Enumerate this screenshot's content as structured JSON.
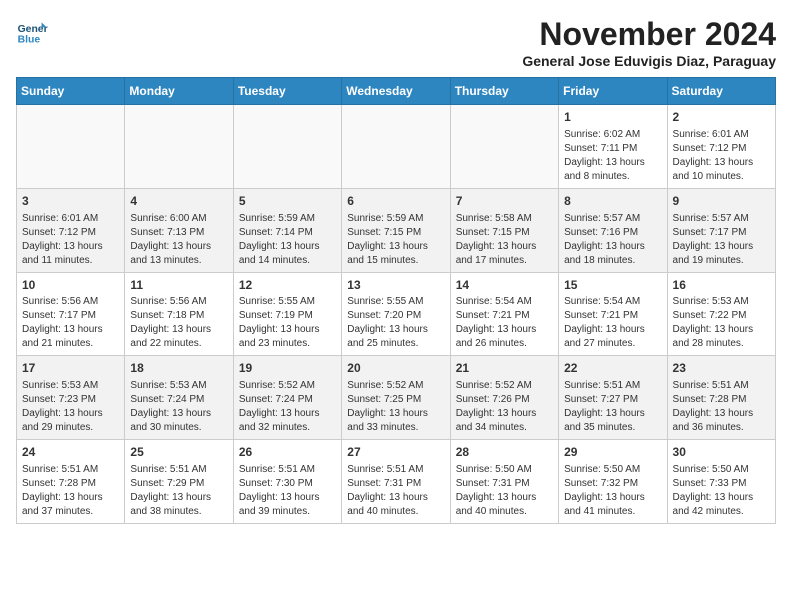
{
  "header": {
    "logo_line1": "General",
    "logo_line2": "Blue",
    "month_title": "November 2024",
    "subtitle": "General Jose Eduvigis Diaz, Paraguay"
  },
  "days_of_week": [
    "Sunday",
    "Monday",
    "Tuesday",
    "Wednesday",
    "Thursday",
    "Friday",
    "Saturday"
  ],
  "weeks": [
    [
      {
        "day": "",
        "content": ""
      },
      {
        "day": "",
        "content": ""
      },
      {
        "day": "",
        "content": ""
      },
      {
        "day": "",
        "content": ""
      },
      {
        "day": "",
        "content": ""
      },
      {
        "day": "1",
        "content": "Sunrise: 6:02 AM\nSunset: 7:11 PM\nDaylight: 13 hours and 8 minutes."
      },
      {
        "day": "2",
        "content": "Sunrise: 6:01 AM\nSunset: 7:12 PM\nDaylight: 13 hours and 10 minutes."
      }
    ],
    [
      {
        "day": "3",
        "content": "Sunrise: 6:01 AM\nSunset: 7:12 PM\nDaylight: 13 hours and 11 minutes."
      },
      {
        "day": "4",
        "content": "Sunrise: 6:00 AM\nSunset: 7:13 PM\nDaylight: 13 hours and 13 minutes."
      },
      {
        "day": "5",
        "content": "Sunrise: 5:59 AM\nSunset: 7:14 PM\nDaylight: 13 hours and 14 minutes."
      },
      {
        "day": "6",
        "content": "Sunrise: 5:59 AM\nSunset: 7:15 PM\nDaylight: 13 hours and 15 minutes."
      },
      {
        "day": "7",
        "content": "Sunrise: 5:58 AM\nSunset: 7:15 PM\nDaylight: 13 hours and 17 minutes."
      },
      {
        "day": "8",
        "content": "Sunrise: 5:57 AM\nSunset: 7:16 PM\nDaylight: 13 hours and 18 minutes."
      },
      {
        "day": "9",
        "content": "Sunrise: 5:57 AM\nSunset: 7:17 PM\nDaylight: 13 hours and 19 minutes."
      }
    ],
    [
      {
        "day": "10",
        "content": "Sunrise: 5:56 AM\nSunset: 7:17 PM\nDaylight: 13 hours and 21 minutes."
      },
      {
        "day": "11",
        "content": "Sunrise: 5:56 AM\nSunset: 7:18 PM\nDaylight: 13 hours and 22 minutes."
      },
      {
        "day": "12",
        "content": "Sunrise: 5:55 AM\nSunset: 7:19 PM\nDaylight: 13 hours and 23 minutes."
      },
      {
        "day": "13",
        "content": "Sunrise: 5:55 AM\nSunset: 7:20 PM\nDaylight: 13 hours and 25 minutes."
      },
      {
        "day": "14",
        "content": "Sunrise: 5:54 AM\nSunset: 7:21 PM\nDaylight: 13 hours and 26 minutes."
      },
      {
        "day": "15",
        "content": "Sunrise: 5:54 AM\nSunset: 7:21 PM\nDaylight: 13 hours and 27 minutes."
      },
      {
        "day": "16",
        "content": "Sunrise: 5:53 AM\nSunset: 7:22 PM\nDaylight: 13 hours and 28 minutes."
      }
    ],
    [
      {
        "day": "17",
        "content": "Sunrise: 5:53 AM\nSunset: 7:23 PM\nDaylight: 13 hours and 29 minutes."
      },
      {
        "day": "18",
        "content": "Sunrise: 5:53 AM\nSunset: 7:24 PM\nDaylight: 13 hours and 30 minutes."
      },
      {
        "day": "19",
        "content": "Sunrise: 5:52 AM\nSunset: 7:24 PM\nDaylight: 13 hours and 32 minutes."
      },
      {
        "day": "20",
        "content": "Sunrise: 5:52 AM\nSunset: 7:25 PM\nDaylight: 13 hours and 33 minutes."
      },
      {
        "day": "21",
        "content": "Sunrise: 5:52 AM\nSunset: 7:26 PM\nDaylight: 13 hours and 34 minutes."
      },
      {
        "day": "22",
        "content": "Sunrise: 5:51 AM\nSunset: 7:27 PM\nDaylight: 13 hours and 35 minutes."
      },
      {
        "day": "23",
        "content": "Sunrise: 5:51 AM\nSunset: 7:28 PM\nDaylight: 13 hours and 36 minutes."
      }
    ],
    [
      {
        "day": "24",
        "content": "Sunrise: 5:51 AM\nSunset: 7:28 PM\nDaylight: 13 hours and 37 minutes."
      },
      {
        "day": "25",
        "content": "Sunrise: 5:51 AM\nSunset: 7:29 PM\nDaylight: 13 hours and 38 minutes."
      },
      {
        "day": "26",
        "content": "Sunrise: 5:51 AM\nSunset: 7:30 PM\nDaylight: 13 hours and 39 minutes."
      },
      {
        "day": "27",
        "content": "Sunrise: 5:51 AM\nSunset: 7:31 PM\nDaylight: 13 hours and 40 minutes."
      },
      {
        "day": "28",
        "content": "Sunrise: 5:50 AM\nSunset: 7:31 PM\nDaylight: 13 hours and 40 minutes."
      },
      {
        "day": "29",
        "content": "Sunrise: 5:50 AM\nSunset: 7:32 PM\nDaylight: 13 hours and 41 minutes."
      },
      {
        "day": "30",
        "content": "Sunrise: 5:50 AM\nSunset: 7:33 PM\nDaylight: 13 hours and 42 minutes."
      }
    ]
  ]
}
